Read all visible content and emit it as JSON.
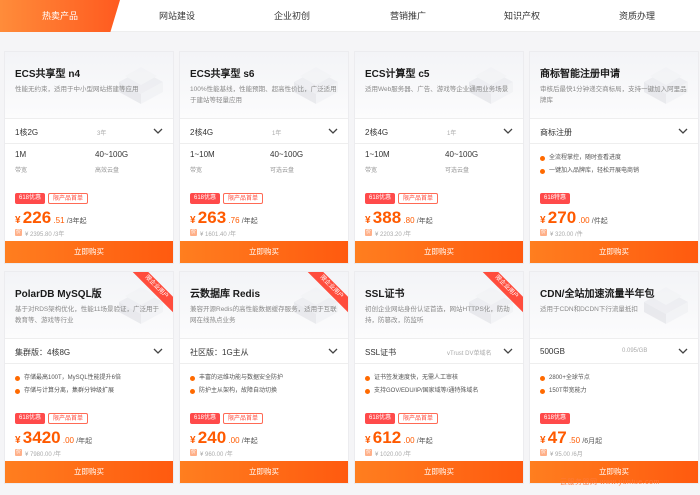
{
  "tabs": [
    {
      "label": "热卖产品",
      "active": true
    },
    {
      "label": "网站建设",
      "active": false
    },
    {
      "label": "企业初创",
      "active": false
    },
    {
      "label": "营销推广",
      "active": false
    },
    {
      "label": "知识产权",
      "active": false
    },
    {
      "label": "资质办理",
      "active": false
    }
  ],
  "products": [
    {
      "title": "ECS共享型 n4",
      "desc": "性能无约束，适用于中小型网站搭建等应用",
      "select_value": "1核2G",
      "select_sub": "3年",
      "specs": [
        {
          "value": "1M",
          "label": "带宽"
        },
        {
          "value": "40~100G",
          "label": "高效云盘"
        }
      ],
      "badges": [
        "618优惠",
        "限产品首单"
      ],
      "price": {
        "currency": "¥",
        "int": "226",
        "dec": ".51",
        "unit": " /3年起"
      },
      "original": "¥ 2395.80 /3年",
      "buy_label": "立即购买"
    },
    {
      "title": "ECS共享型 s6",
      "desc": "100%性能基线，性能预期、超高性价比，广泛适用于建站等轻量应用",
      "select_value": "2核4G",
      "select_sub": "1年",
      "specs": [
        {
          "value": "1~10M",
          "label": "带宽"
        },
        {
          "value": "40~100G",
          "label": "可选云盘"
        }
      ],
      "badges": [
        "618优惠",
        "限产品首单"
      ],
      "price": {
        "currency": "¥",
        "int": "263",
        "dec": ".76",
        "unit": " /年起"
      },
      "original": "¥ 1601.40 /年",
      "buy_label": "立即购买"
    },
    {
      "title": "ECS计算型 c5",
      "desc": "适用Web服务器、广告、游戏等企业通用业务场景",
      "select_value": "2核4G",
      "select_sub": "1年",
      "specs": [
        {
          "value": "1~10M",
          "label": "带宽"
        },
        {
          "value": "40~100G",
          "label": "可选云盘"
        }
      ],
      "badges": [
        "618优惠",
        "限产品首单"
      ],
      "price": {
        "currency": "¥",
        "int": "388",
        "dec": ".80",
        "unit": " /年起"
      },
      "original": "¥ 2203.20 /年",
      "buy_label": "立即购买"
    },
    {
      "title": "商标智能注册申请",
      "desc": "审核后最快1分钟递交商标局，支持一键加入阿里品牌库",
      "select_value": "商标注册",
      "select_sub": "",
      "features": [
        "全流程掌控，随时查看进度",
        "一键加入品牌库，轻松开展电商销"
      ],
      "badges": [
        "618特惠"
      ],
      "price": {
        "currency": "¥",
        "int": "270",
        "dec": ".00",
        "unit": " /件起"
      },
      "original": "¥ 320.00 /件",
      "buy_label": "立即购买"
    },
    {
      "title": "PolarDB MySQL版",
      "desc": "基于对RDS架构优化，性能11场景验证，广泛用于教育等、游戏等行业",
      "select_value": "集群版：4核8G",
      "select_sub": "",
      "features": [
        "存储最高100T，MySQL性能提升6倍",
        "存储与计算分离，集群分钟级扩展"
      ],
      "badges": [
        "618优惠",
        "限产品首单"
      ],
      "price": {
        "currency": "¥",
        "int": "3420",
        "dec": ".00",
        "unit": " /年起"
      },
      "original": "¥ 7980.00 /年",
      "buy_label": "立即购买",
      "ribbon": "限企业用户"
    },
    {
      "title": "云数据库 Redis",
      "desc": "兼容开源Redis的高性能数据缓存服务，适用于互联网在线热点业务",
      "select_value": "社区版：1G主从",
      "select_sub": "",
      "features": [
        "丰富的运维功能与数据安全防护",
        "防护主从架构，故障自动切换"
      ],
      "badges": [
        "618优惠",
        "限产品首单"
      ],
      "price": {
        "currency": "¥",
        "int": "240",
        "dec": ".00",
        "unit": " /年起"
      },
      "original": "¥ 960.00 /年",
      "buy_label": "立即购买",
      "ribbon": "限企业用户"
    },
    {
      "title": "SSL证书",
      "desc": "初创企业网站身份认证首选，网站HTTPS化，防劫持，防篡改，防监听",
      "select_value": "SSL证书",
      "select_sub": "vTrust DV单域名",
      "features": [
        "证书签发速度快，无需人工审核",
        "支持GOV/EDU/IP/国家域等/通特殊域名"
      ],
      "badges": [
        "618优惠",
        "限产品首单"
      ],
      "price": {
        "currency": "¥",
        "int": "612",
        "dec": ".00",
        "unit": " /年起"
      },
      "original": "¥ 1020.00 /年",
      "buy_label": "立即购买",
      "ribbon": "限企业用户"
    },
    {
      "title": "CDN/全站加速流量半年包",
      "desc": "适用于CDN和DCDN下行流量抵扣",
      "select_value": "500GB",
      "select_sub": "0.095/GB",
      "features": [
        "2800+全球节点",
        "150T带宽能力"
      ],
      "badges": [
        "618优惠"
      ],
      "price": {
        "currency": "¥",
        "int": "47",
        "dec": ".50",
        "unit": " /6月起"
      },
      "original": "¥ 95.00 /6月",
      "buy_label": "立即购买"
    }
  ],
  "watermark": "云服务器网 www.yuntue.com",
  "colors": {
    "accent": "#ff6a00",
    "badge_red": "#ff4a4a"
  }
}
